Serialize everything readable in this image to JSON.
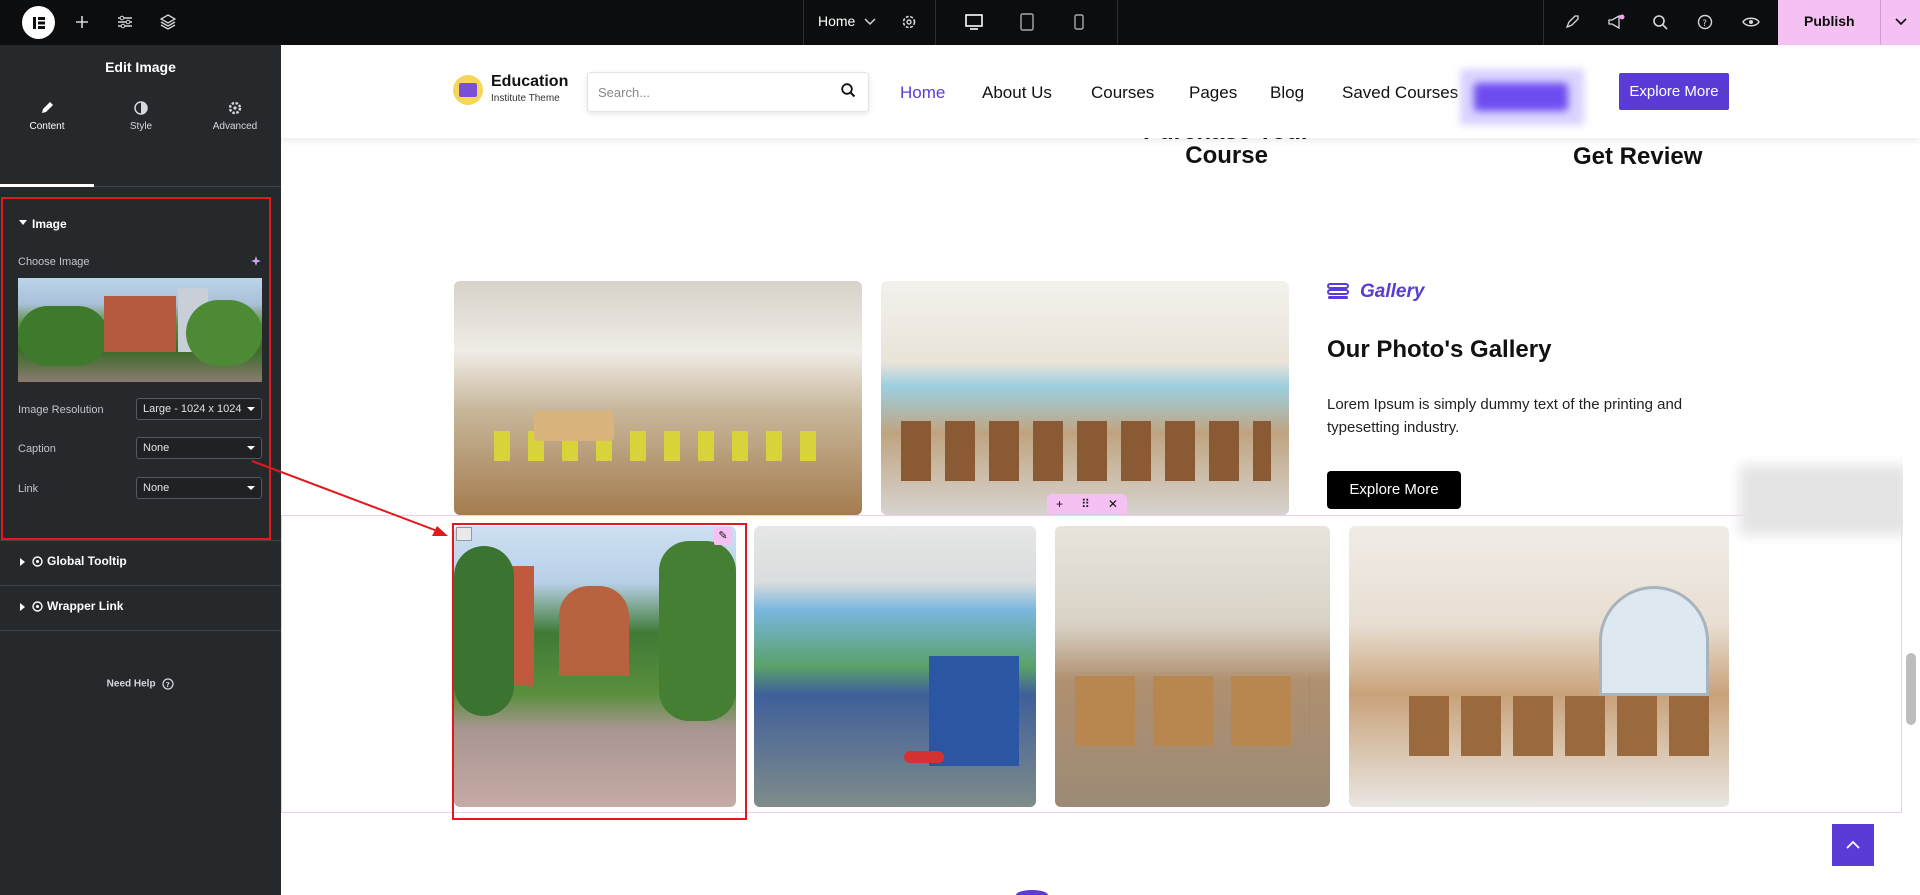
{
  "topbar": {
    "page_select": "Home",
    "publish_label": "Publish"
  },
  "panel": {
    "title": "Edit Image",
    "tabs": [
      {
        "label": "Content",
        "icon": "pencil-icon"
      },
      {
        "label": "Style",
        "icon": "contrast-icon"
      },
      {
        "label": "Advanced",
        "icon": "gear-icon"
      }
    ],
    "section_image": "Image",
    "choose_image_label": "Choose Image",
    "image_resolution_label": "Image Resolution",
    "image_resolution_value": "Large - 1024 x 1024",
    "caption_label": "Caption",
    "caption_value": "None",
    "link_label": "Link",
    "link_value": "None",
    "global_tooltip": "Global Tooltip",
    "wrapper_link": "Wrapper Link",
    "need_help": "Need Help"
  },
  "site": {
    "brand_name": "Education",
    "brand_sub": "Institute Theme",
    "search_placeholder": "Search...",
    "nav": [
      "Home",
      "About Us",
      "Courses",
      "Pages",
      "Blog",
      "Saved Courses"
    ],
    "explore_top": "Explore More",
    "feature_1": "Purchase Your\nCourse",
    "feature_2": "Get Review",
    "gallery_tag": "Gallery",
    "gallery_heading": "Our Photo's Gallery",
    "gallery_text": "Lorem Ipsum is simply dummy text of the printing and typesetting industry.",
    "explore_dark": "Explore More"
  },
  "colors": {
    "accent": "#5b3bd6",
    "publish": "#f5c0f2",
    "panel_bg": "#26292c",
    "annotation_red": "#e0191f"
  }
}
